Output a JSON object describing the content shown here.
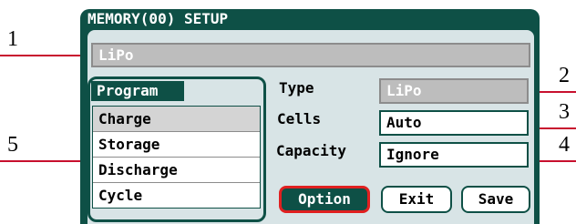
{
  "callouts": [
    "1",
    "2",
    "3",
    "4",
    "5"
  ],
  "screen": {
    "title": "MEMORY(00) SETUP",
    "memory_name": "LiPo",
    "program": {
      "label": "Program",
      "items": [
        {
          "label": "Charge",
          "selected": true
        },
        {
          "label": "Storage",
          "selected": false
        },
        {
          "label": "Discharge",
          "selected": false
        },
        {
          "label": "Cycle",
          "selected": false
        }
      ]
    },
    "fields": {
      "type": {
        "label": "Type",
        "value": "LiPo"
      },
      "cells": {
        "label": "Cells",
        "value": "Auto"
      },
      "capacity": {
        "label": "Capacity",
        "value": "Ignore"
      }
    },
    "buttons": {
      "option": "Option",
      "exit": "Exit",
      "save": "Save"
    }
  },
  "colors": {
    "screen_bg": "#0e5046",
    "panel_bg": "#d8e4e6",
    "disabled_bg": "#bdbdbd",
    "focus_border": "#e02020",
    "leader_line": "#c8102e"
  }
}
